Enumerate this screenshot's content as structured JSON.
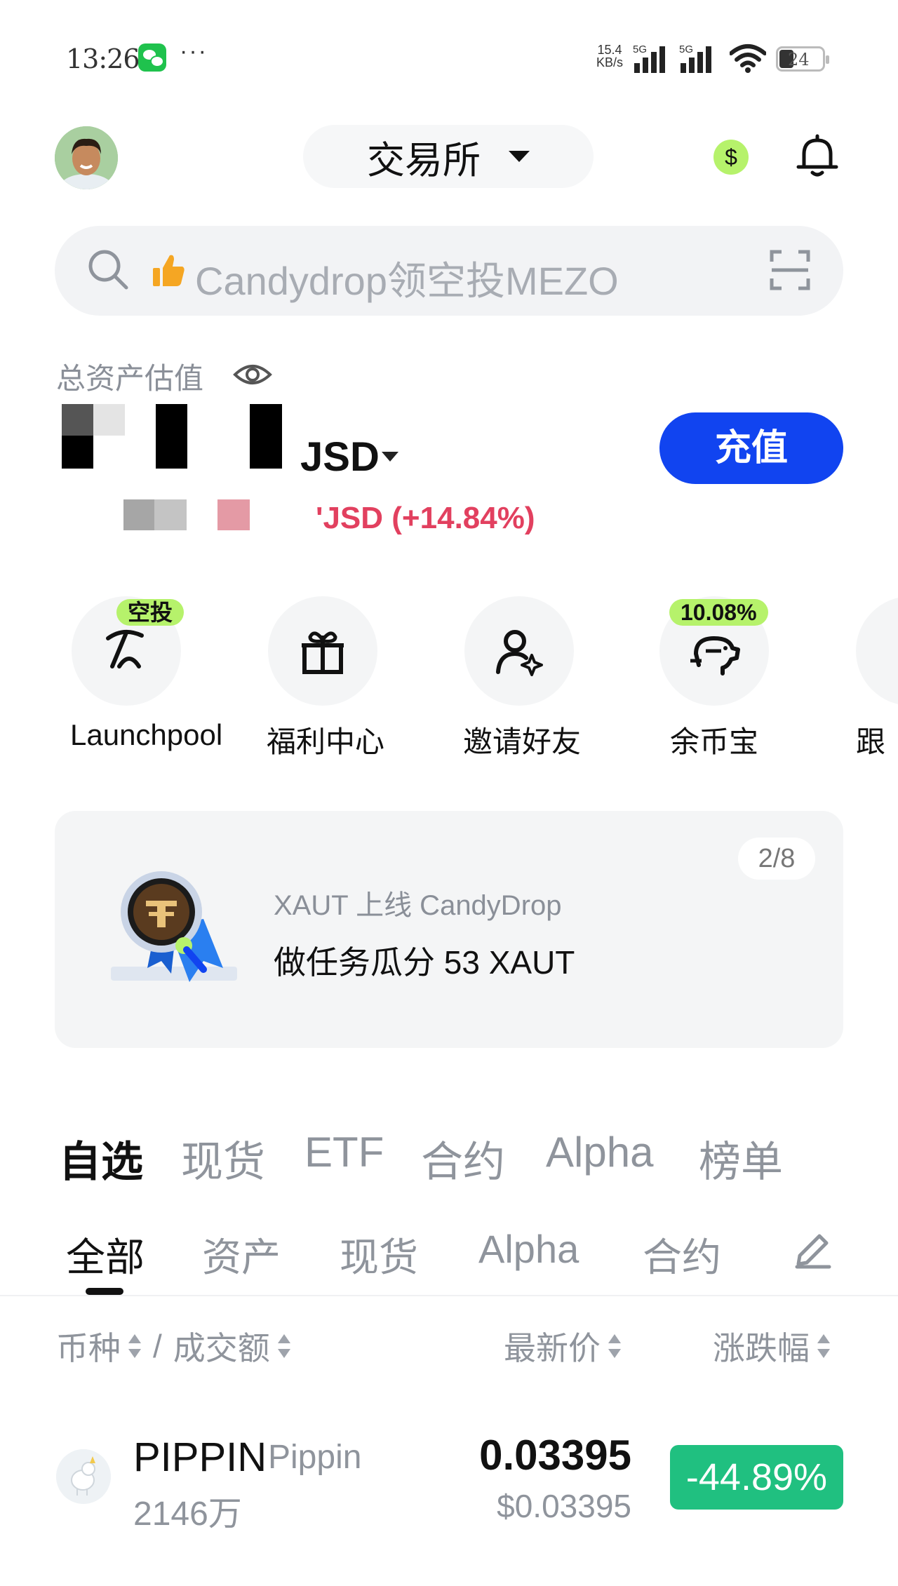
{
  "status_bar": {
    "time": "13:26",
    "network_speed_value": "15.4",
    "network_speed_unit": "KB/s",
    "signal1_tag": "5G",
    "signal2_tag": "5G",
    "battery": "24"
  },
  "header": {
    "exchange_label": "交易所"
  },
  "search": {
    "placeholder": "Candydrop领空投MEZO"
  },
  "assets": {
    "label": "总资产估值",
    "currency": "JSD",
    "deposit_label": "充值",
    "pnl_text": "'JSD (+14.84%)"
  },
  "quick_actions": [
    {
      "label": "Launchpool",
      "badge": "空投"
    },
    {
      "label": "福利中心"
    },
    {
      "label": "邀请好友"
    },
    {
      "label": "余币宝",
      "badge": "10.08%"
    },
    {
      "label": "跟"
    }
  ],
  "banner": {
    "pager": "2/8",
    "subtitle": "XAUT 上线 CandyDrop",
    "title": "做任务瓜分 53 XAUT"
  },
  "market_tabs": [
    "自选",
    "现货",
    "ETF",
    "合约",
    "Alpha",
    "榜单"
  ],
  "sub_tabs": [
    "全部",
    "资产",
    "现货",
    "Alpha",
    "合约"
  ],
  "columns": {
    "coin": "币种",
    "separator": "/",
    "volume": "成交额",
    "price": "最新价",
    "change": "涨跌幅"
  },
  "rows": [
    {
      "symbol": "PIPPIN",
      "name": "Pippin",
      "volume": "2146万",
      "price": "0.03395",
      "price_usd": "$0.03395",
      "change": "-44.89%"
    }
  ],
  "colors": {
    "accent_blue": "#1144f0",
    "badge_green": "#b6f26b",
    "down_green": "#20c080",
    "pnl_red": "#e2405f"
  }
}
